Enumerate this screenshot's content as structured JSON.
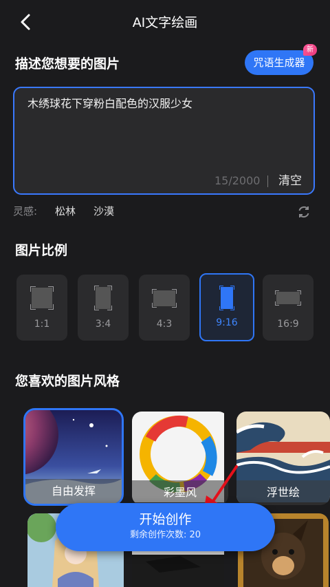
{
  "header": {
    "title": "AI文字绘画",
    "back_icon": "chevron-left-icon"
  },
  "describe": {
    "title": "描述您想要的图片",
    "spell_button": "咒语生成器",
    "new_badge": "新",
    "text": "木绣球花下穿粉白配色的汉服少女",
    "counter": "15/2000",
    "clear": "清空"
  },
  "inspiration": {
    "label": "灵感:",
    "tags": [
      "松林",
      "沙漠"
    ],
    "refresh_icon": "refresh-icon"
  },
  "ratio": {
    "title": "图片比例",
    "options": [
      "1:1",
      "3:4",
      "4:3",
      "9:16",
      "16:9"
    ],
    "selected": "9:16"
  },
  "styles": {
    "title": "您喜欢的图片风格",
    "cards": [
      "自由发挥",
      "彩墨风",
      "浮世绘"
    ],
    "selected": "自由发挥"
  },
  "start": {
    "label": "开始创作",
    "remaining": "剩余创作次数: 20"
  },
  "colors": {
    "accent": "#2f76f6",
    "background": "#1b1b1d"
  }
}
